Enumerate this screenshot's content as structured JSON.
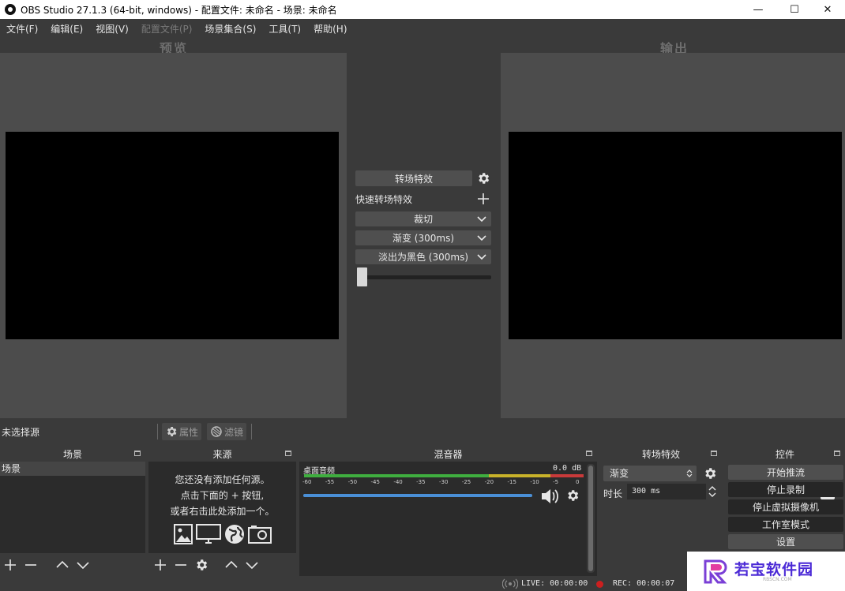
{
  "window": {
    "title": "OBS Studio 27.1.3 (64-bit, windows) - 配置文件: 未命名 - 场景: 未命名",
    "minimize": "—",
    "maximize": "☐",
    "close": "✕"
  },
  "menu": {
    "items": [
      "文件(F)",
      "编辑(E)",
      "视图(V)",
      "配置文件(P)",
      "场景集合(S)",
      "工具(T)",
      "帮助(H)"
    ]
  },
  "preview": {
    "title": "预览"
  },
  "program": {
    "title": "输出"
  },
  "studio_transition": {
    "button_label": "转场特效",
    "quick_label": "快速转场特效",
    "options": [
      "裁切",
      "渐变 (300ms)",
      "淡出为黑色 (300ms)"
    ],
    "slider_value": 0
  },
  "source_toolbar": {
    "no_source": "未选择源",
    "properties": "属性",
    "filters": "滤镜"
  },
  "docks": {
    "scenes": {
      "title": "场景",
      "items": [
        "场景"
      ]
    },
    "sources": {
      "title": "来源",
      "empty_line1": "您还没有添加任何源。",
      "empty_line2": "点击下面的 + 按钮,",
      "empty_line3": "或者右击此处添加一个。"
    },
    "mixer": {
      "title": "混音器",
      "track_name": "桌面音频",
      "db_value": "0.0 dB",
      "ticks": [
        "-60",
        "-55",
        "-50",
        "-45",
        "-40",
        "-35",
        "-30",
        "-25",
        "-20",
        "-15",
        "-10",
        "-5",
        "0"
      ],
      "volume": 1.0
    },
    "transitions": {
      "title": "转场特效",
      "selected": "渐变",
      "duration_label": "时长",
      "duration_value": "300 ms"
    },
    "controls": {
      "title": "控件",
      "buttons": [
        "开始推流",
        "停止录制",
        "停止虚拟摄像机",
        "工作室模式",
        "设置"
      ]
    }
  },
  "status": {
    "live": "LIVE: 00:00:00",
    "rec": "REC: 00:00:07"
  },
  "watermark": {
    "text": "若宝软件园",
    "sub": "RBSCN.COM"
  },
  "colors": {
    "rec_dot": "#cc1f1f",
    "meter_green": "#3fae3f",
    "meter_yellow": "#c8b22a",
    "meter_red": "#c83a3a",
    "volume_blue": "#4a8fd6"
  }
}
